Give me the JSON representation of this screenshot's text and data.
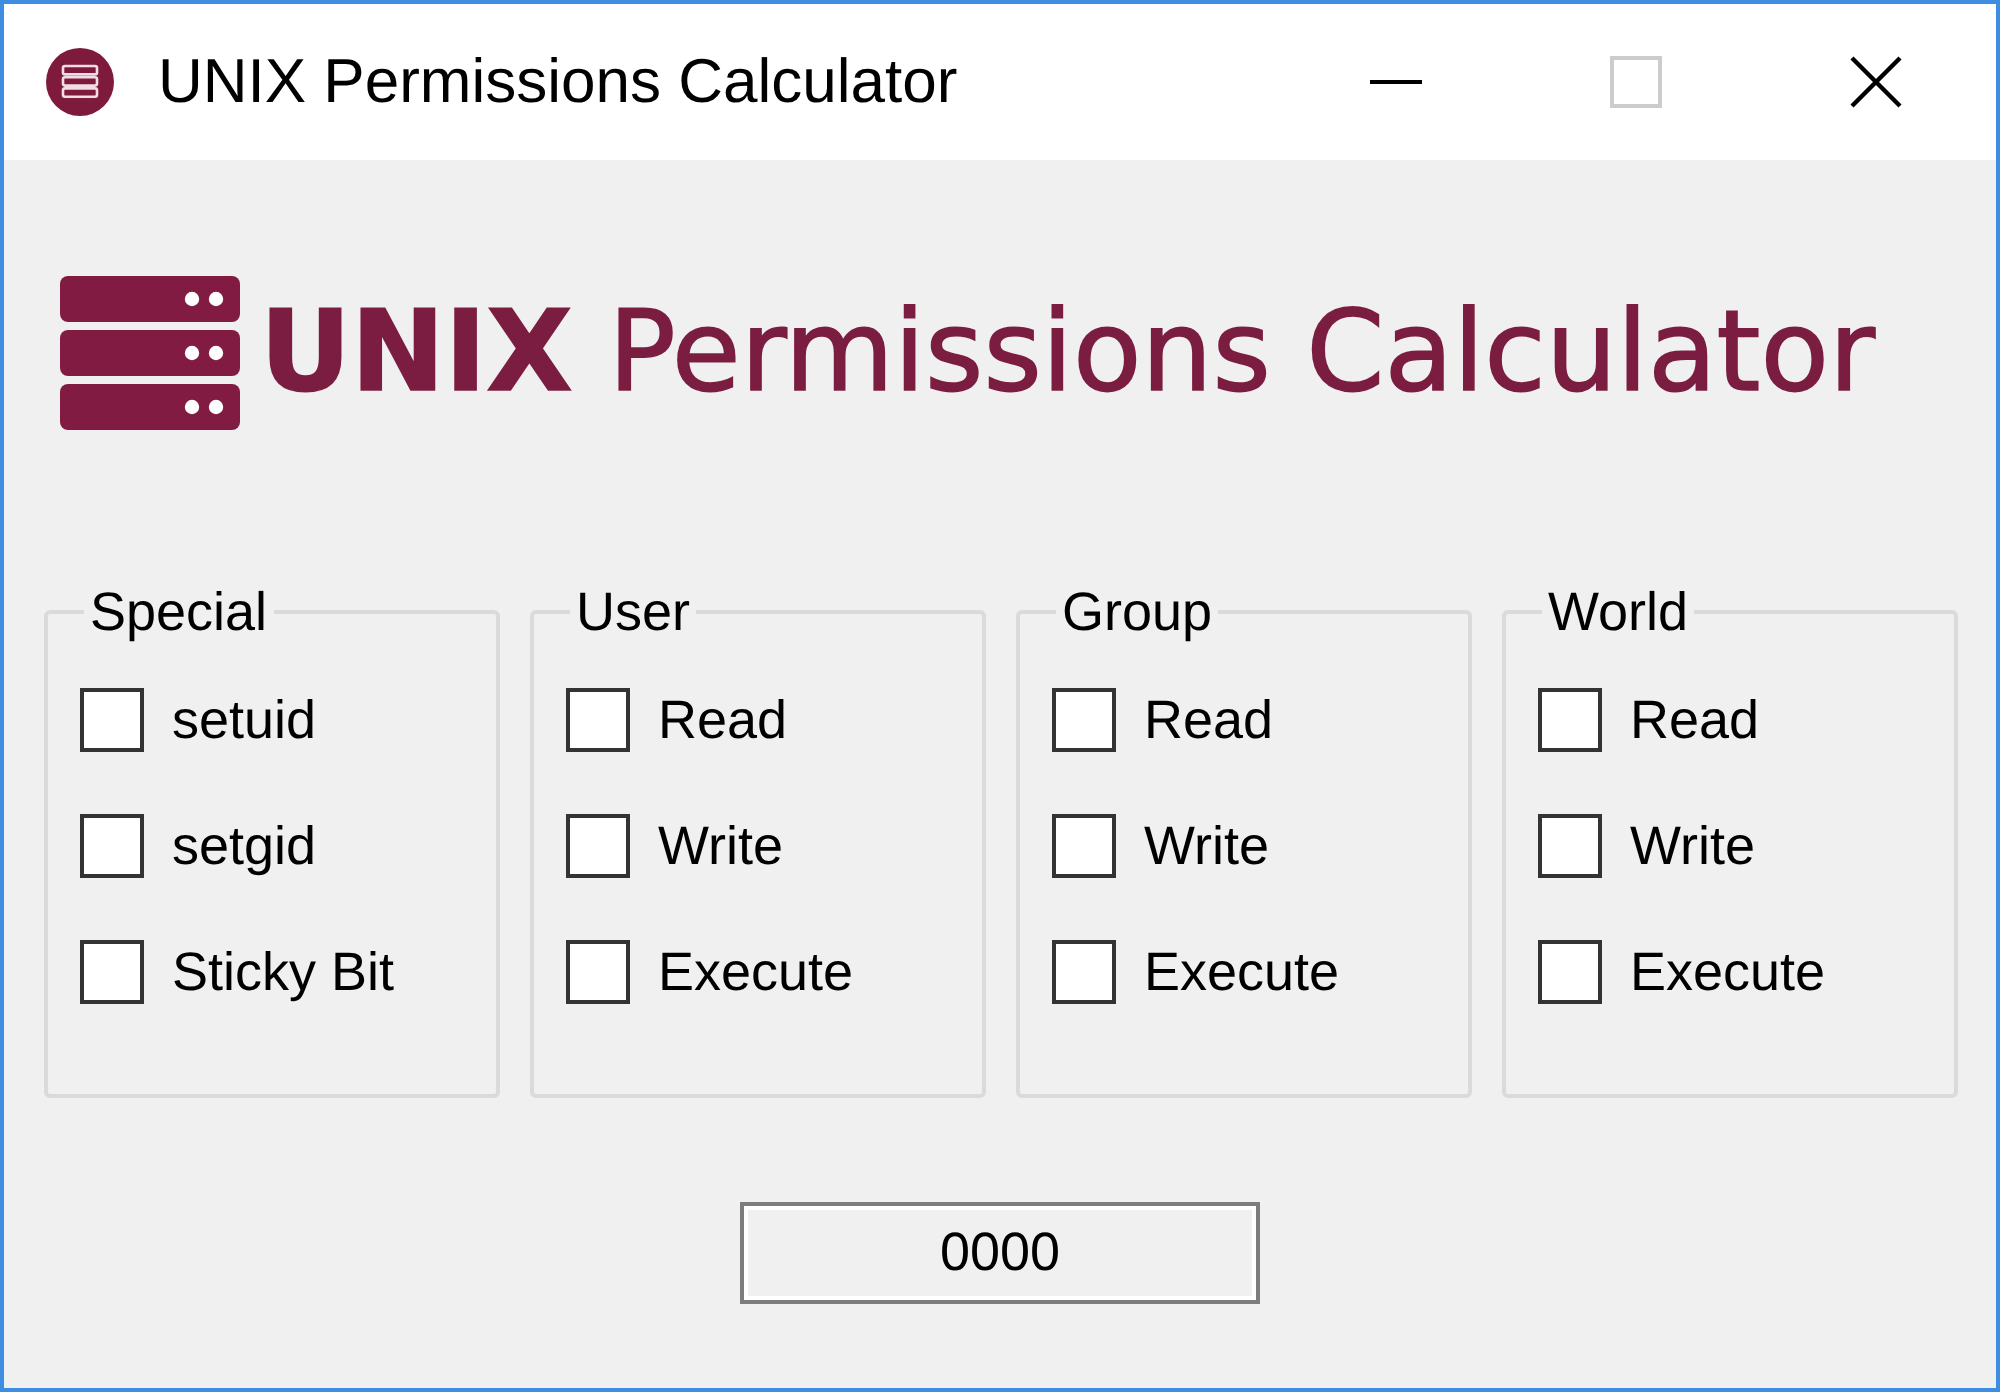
{
  "window": {
    "title": "UNIX Permissions Calculator",
    "controls": [
      {
        "kind": "minimize",
        "disabled": false
      },
      {
        "kind": "maximize",
        "disabled": true
      },
      {
        "kind": "close",
        "disabled": false
      }
    ]
  },
  "banner": {
    "title": "**UNIX** Permissions Calculator"
  },
  "groups": [
    {
      "title": "Special",
      "options": [
        {
          "label": "setuid",
          "checked": false
        },
        {
          "label": "setgid",
          "checked": false
        },
        {
          "label": "Sticky Bit",
          "checked": false
        }
      ]
    },
    {
      "title": "User",
      "options": [
        {
          "label": "Read",
          "checked": false
        },
        {
          "label": "Write",
          "checked": false
        },
        {
          "label": "Execute",
          "checked": false
        }
      ]
    },
    {
      "title": "Group",
      "options": [
        {
          "label": "Read",
          "checked": false
        },
        {
          "label": "Write",
          "checked": false
        },
        {
          "label": "Execute",
          "checked": false
        }
      ]
    },
    {
      "title": "World",
      "options": [
        {
          "label": "Read",
          "checked": false
        },
        {
          "label": "Write",
          "checked": false
        },
        {
          "label": "Execute",
          "checked": false
        }
      ]
    }
  ],
  "result": {
    "value": "0000"
  }
}
